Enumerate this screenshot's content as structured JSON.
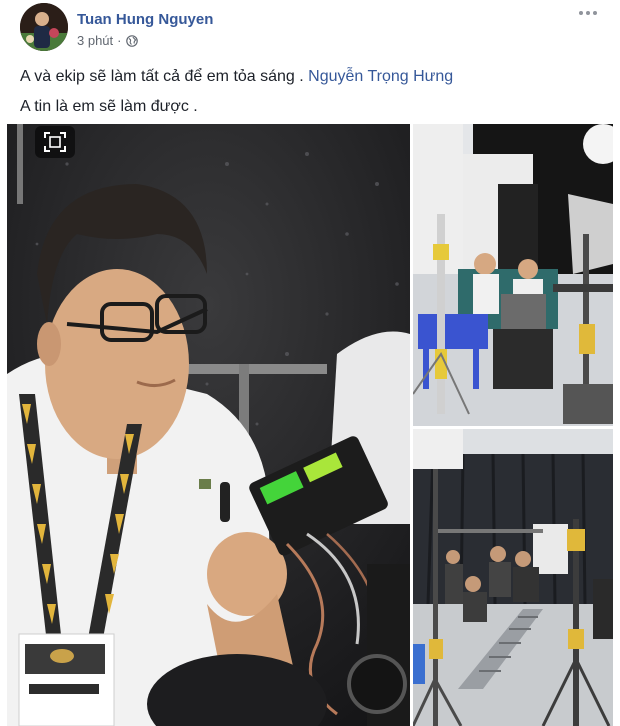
{
  "post": {
    "author": "Tuan Hung Nguyen",
    "time": "3 phút",
    "privacy_icon": "globe-icon",
    "line1_text": "A và ekip sẽ làm tất cả để em tỏa sáng .",
    "line1_mention": "Nguyễn Trọng Hưng",
    "line2_text": "A tin là em sẽ làm được ."
  },
  "icons": {
    "more": "ellipsis-icon",
    "frame": "frame-icon"
  },
  "photos": [
    {
      "subject": "man-with-glasses-and-camera"
    },
    {
      "subject": "film-studio-crew-seated"
    },
    {
      "subject": "film-studio-camera-dolly"
    }
  ],
  "colors": {
    "link": "#365899",
    "text": "#1d2129",
    "meta": "#616770"
  }
}
